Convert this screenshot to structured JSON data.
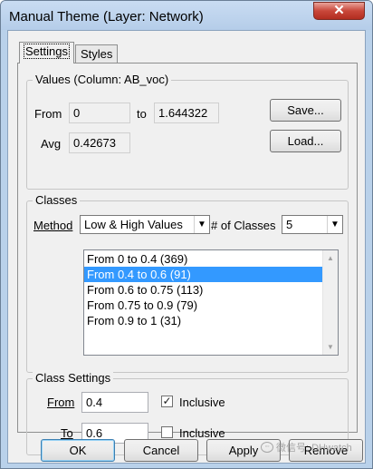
{
  "window": {
    "title": "Manual Theme (Layer: Network)",
    "close_label": "✕"
  },
  "tabs": [
    {
      "label": "Settings"
    },
    {
      "label": "Styles"
    }
  ],
  "values_group": {
    "title": "Values (Column: AB_voc)",
    "from_label": "From",
    "from_value": "0",
    "to_label": "to",
    "to_value": "1.644322",
    "avg_label": "Avg",
    "avg_value": "0.42673",
    "save_label": "Save...",
    "load_label": "Load..."
  },
  "classes_group": {
    "title": "Classes",
    "method_label": "Method",
    "method_value": "Low & High Values",
    "num_classes_label": "# of Classes",
    "num_classes_value": "5",
    "list_items": [
      "From 0 to 0.4 (369)",
      "From 0.4 to 0.6 (91)",
      "From 0.6 to 0.75 (113)",
      "From 0.75 to 0.9 (79)",
      "From 0.9 to 1 (31)"
    ],
    "selected_index": 1
  },
  "class_settings": {
    "title": "Class Settings",
    "from_label": "From",
    "from_value": "0.4",
    "to_label": "To",
    "to_value": "0.6",
    "inclusive_label": "Inclusive",
    "from_inclusive_checked": true,
    "to_inclusive_checked": false
  },
  "footer": {
    "ok_label": "OK",
    "cancel_label": "Cancel",
    "apply_label": "Apply",
    "remove_label": "Remove"
  },
  "watermark": {
    "text": "微信号: DHwatch"
  }
}
